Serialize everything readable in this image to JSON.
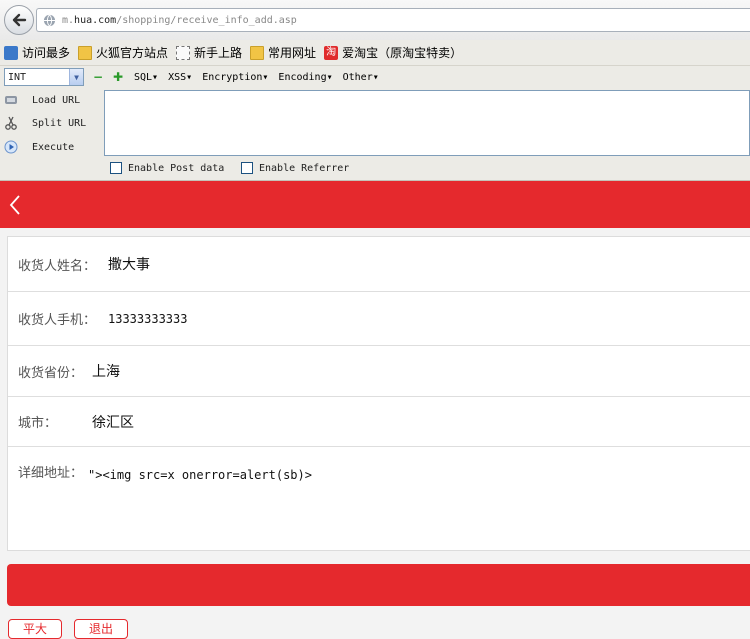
{
  "browser": {
    "url_prefix": "m.",
    "url_host": "hua.com",
    "url_path": "/shopping/receive_info_add.asp"
  },
  "bookmarks": [
    {
      "label": "访问最多",
      "icon": "search-icon"
    },
    {
      "label": "火狐官方站点",
      "icon": "folder-icon"
    },
    {
      "label": "新手上路",
      "icon": "dashed-page-icon"
    },
    {
      "label": "常用网址",
      "icon": "folder-icon"
    },
    {
      "label": "爱淘宝（原淘宝特卖）",
      "icon": "taobao-icon"
    }
  ],
  "hackbar": {
    "select_value": "INT",
    "menus": [
      "SQL▾",
      "XSS▾",
      "Encryption▾",
      "Encoding▾",
      "Other▾"
    ],
    "buttons": [
      "Load URL",
      "Split URL",
      "Execute"
    ],
    "checkboxes": [
      "Enable Post data",
      "Enable Referrer"
    ]
  },
  "form": {
    "name_label": "收货人姓名：",
    "name_value": "撒大事",
    "phone_label": "收货人手机：",
    "phone_value": "13333333333",
    "province_label": "收货省份：",
    "province_value": "上海",
    "city_label": "城市：",
    "city_value": "徐汇区",
    "address_label": "详细地址：",
    "address_value": "\"><img src=x onerror=alert(sb)>"
  },
  "bottom_buttons": [
    "平大",
    "退出"
  ],
  "colors": {
    "accent_red": "#e5292d"
  }
}
